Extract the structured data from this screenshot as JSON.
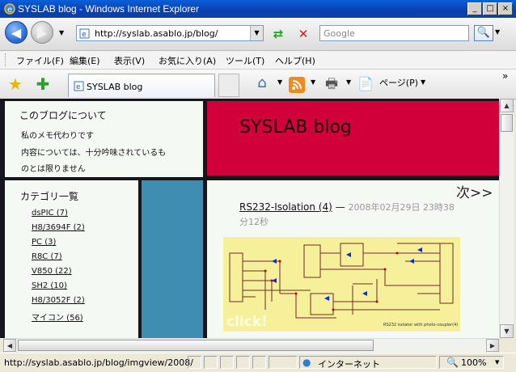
{
  "window": {
    "title": "SYSLAB blog - Windows Internet Explorer",
    "buttons": {
      "minimize": "_",
      "maximize": "□",
      "close": "×"
    }
  },
  "nav": {
    "back_glyph": "◀",
    "forward_glyph": "▶",
    "address": "http://syslab.asablo.jp/blog/",
    "search_placeholder": "Google",
    "search_glyph": "🔍"
  },
  "menu": [
    "ファイル(F)",
    "編集(E)",
    "表示(V)",
    "お気に入り(A)",
    "ツール(T)",
    "ヘルプ(H)"
  ],
  "tab": {
    "label": "SYSLAB blog"
  },
  "commands": {
    "page": "ページ(P)"
  },
  "page": {
    "about": {
      "heading": "このブログについて",
      "lines": [
        "私のメモ代わりです",
        "内容については、十分吟味されているも",
        "のとは限りません"
      ]
    },
    "header_title": "SYSLAB blog",
    "categories": {
      "heading": "カテゴリ一覧",
      "items": [
        "dsPIC (7)",
        "H8/3694F (2)",
        "PC (3)",
        "R8C (7)",
        "V850 (22)",
        "SH2 (10)",
        "H8/3052F (2)",
        "マイコン (56)"
      ]
    },
    "next": "次>>",
    "post": {
      "title": "RS232-Isolation (4)",
      "dash": " — ",
      "date": "2008年02月29日 23時38",
      "date_tail": "分12秒"
    },
    "image": {
      "overlay": "click!",
      "caption": "RS232 isolator with photo-coupler(4)"
    }
  },
  "status": {
    "url": "http://syslab.asablo.jp/blog/imgview/2008/",
    "zone": "インターネット",
    "zoom": "100%"
  },
  "colors": {
    "header_red": "#d2003a",
    "sidebar_blue": "#3f8db0",
    "page_bg": "#15171c",
    "schematic_bg": "#f7f09a"
  }
}
